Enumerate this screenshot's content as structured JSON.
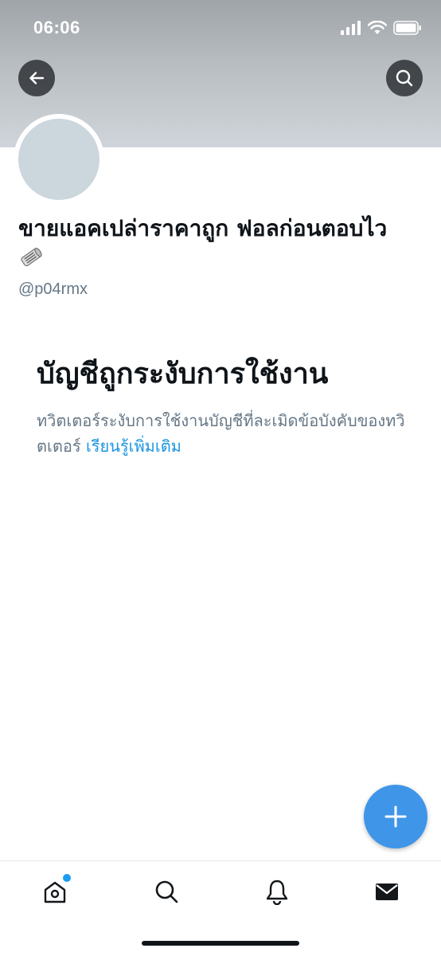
{
  "status_bar": {
    "time": "06:06",
    "icons": [
      "cellular-signal-icon",
      "wifi-icon",
      "battery-icon"
    ]
  },
  "header": {
    "back_icon": "arrow-left-icon",
    "search_icon": "search-icon"
  },
  "profile": {
    "display_name": "ขายแอคเปล่าราคาถูก ฟอลก่อนตอบไว",
    "display_name_emoji": "newspaper-roll-icon",
    "handle": "@p04rmx"
  },
  "suspension": {
    "title": "บัญชีถูกระงับการใช้งาน",
    "body": "ทวิตเตอร์ระงับการใช้งานบัญชีที่ละเมิดข้อบังคับของทวิตเตอร์ ",
    "learn_more": "เรียนรู้เพิ่มเติม"
  },
  "fab": {
    "icon": "plus-icon"
  },
  "tab_bar": {
    "items": [
      {
        "name": "home",
        "icon": "home-icon",
        "has_badge": true
      },
      {
        "name": "search",
        "icon": "search-icon"
      },
      {
        "name": "notifications",
        "icon": "bell-icon"
      },
      {
        "name": "messages",
        "icon": "envelope-icon"
      }
    ]
  },
  "colors": {
    "accent": "#1b95e0",
    "fab": "#3f95e8",
    "secondary_text": "#657786",
    "avatar_placeholder": "#ccd6dd"
  }
}
